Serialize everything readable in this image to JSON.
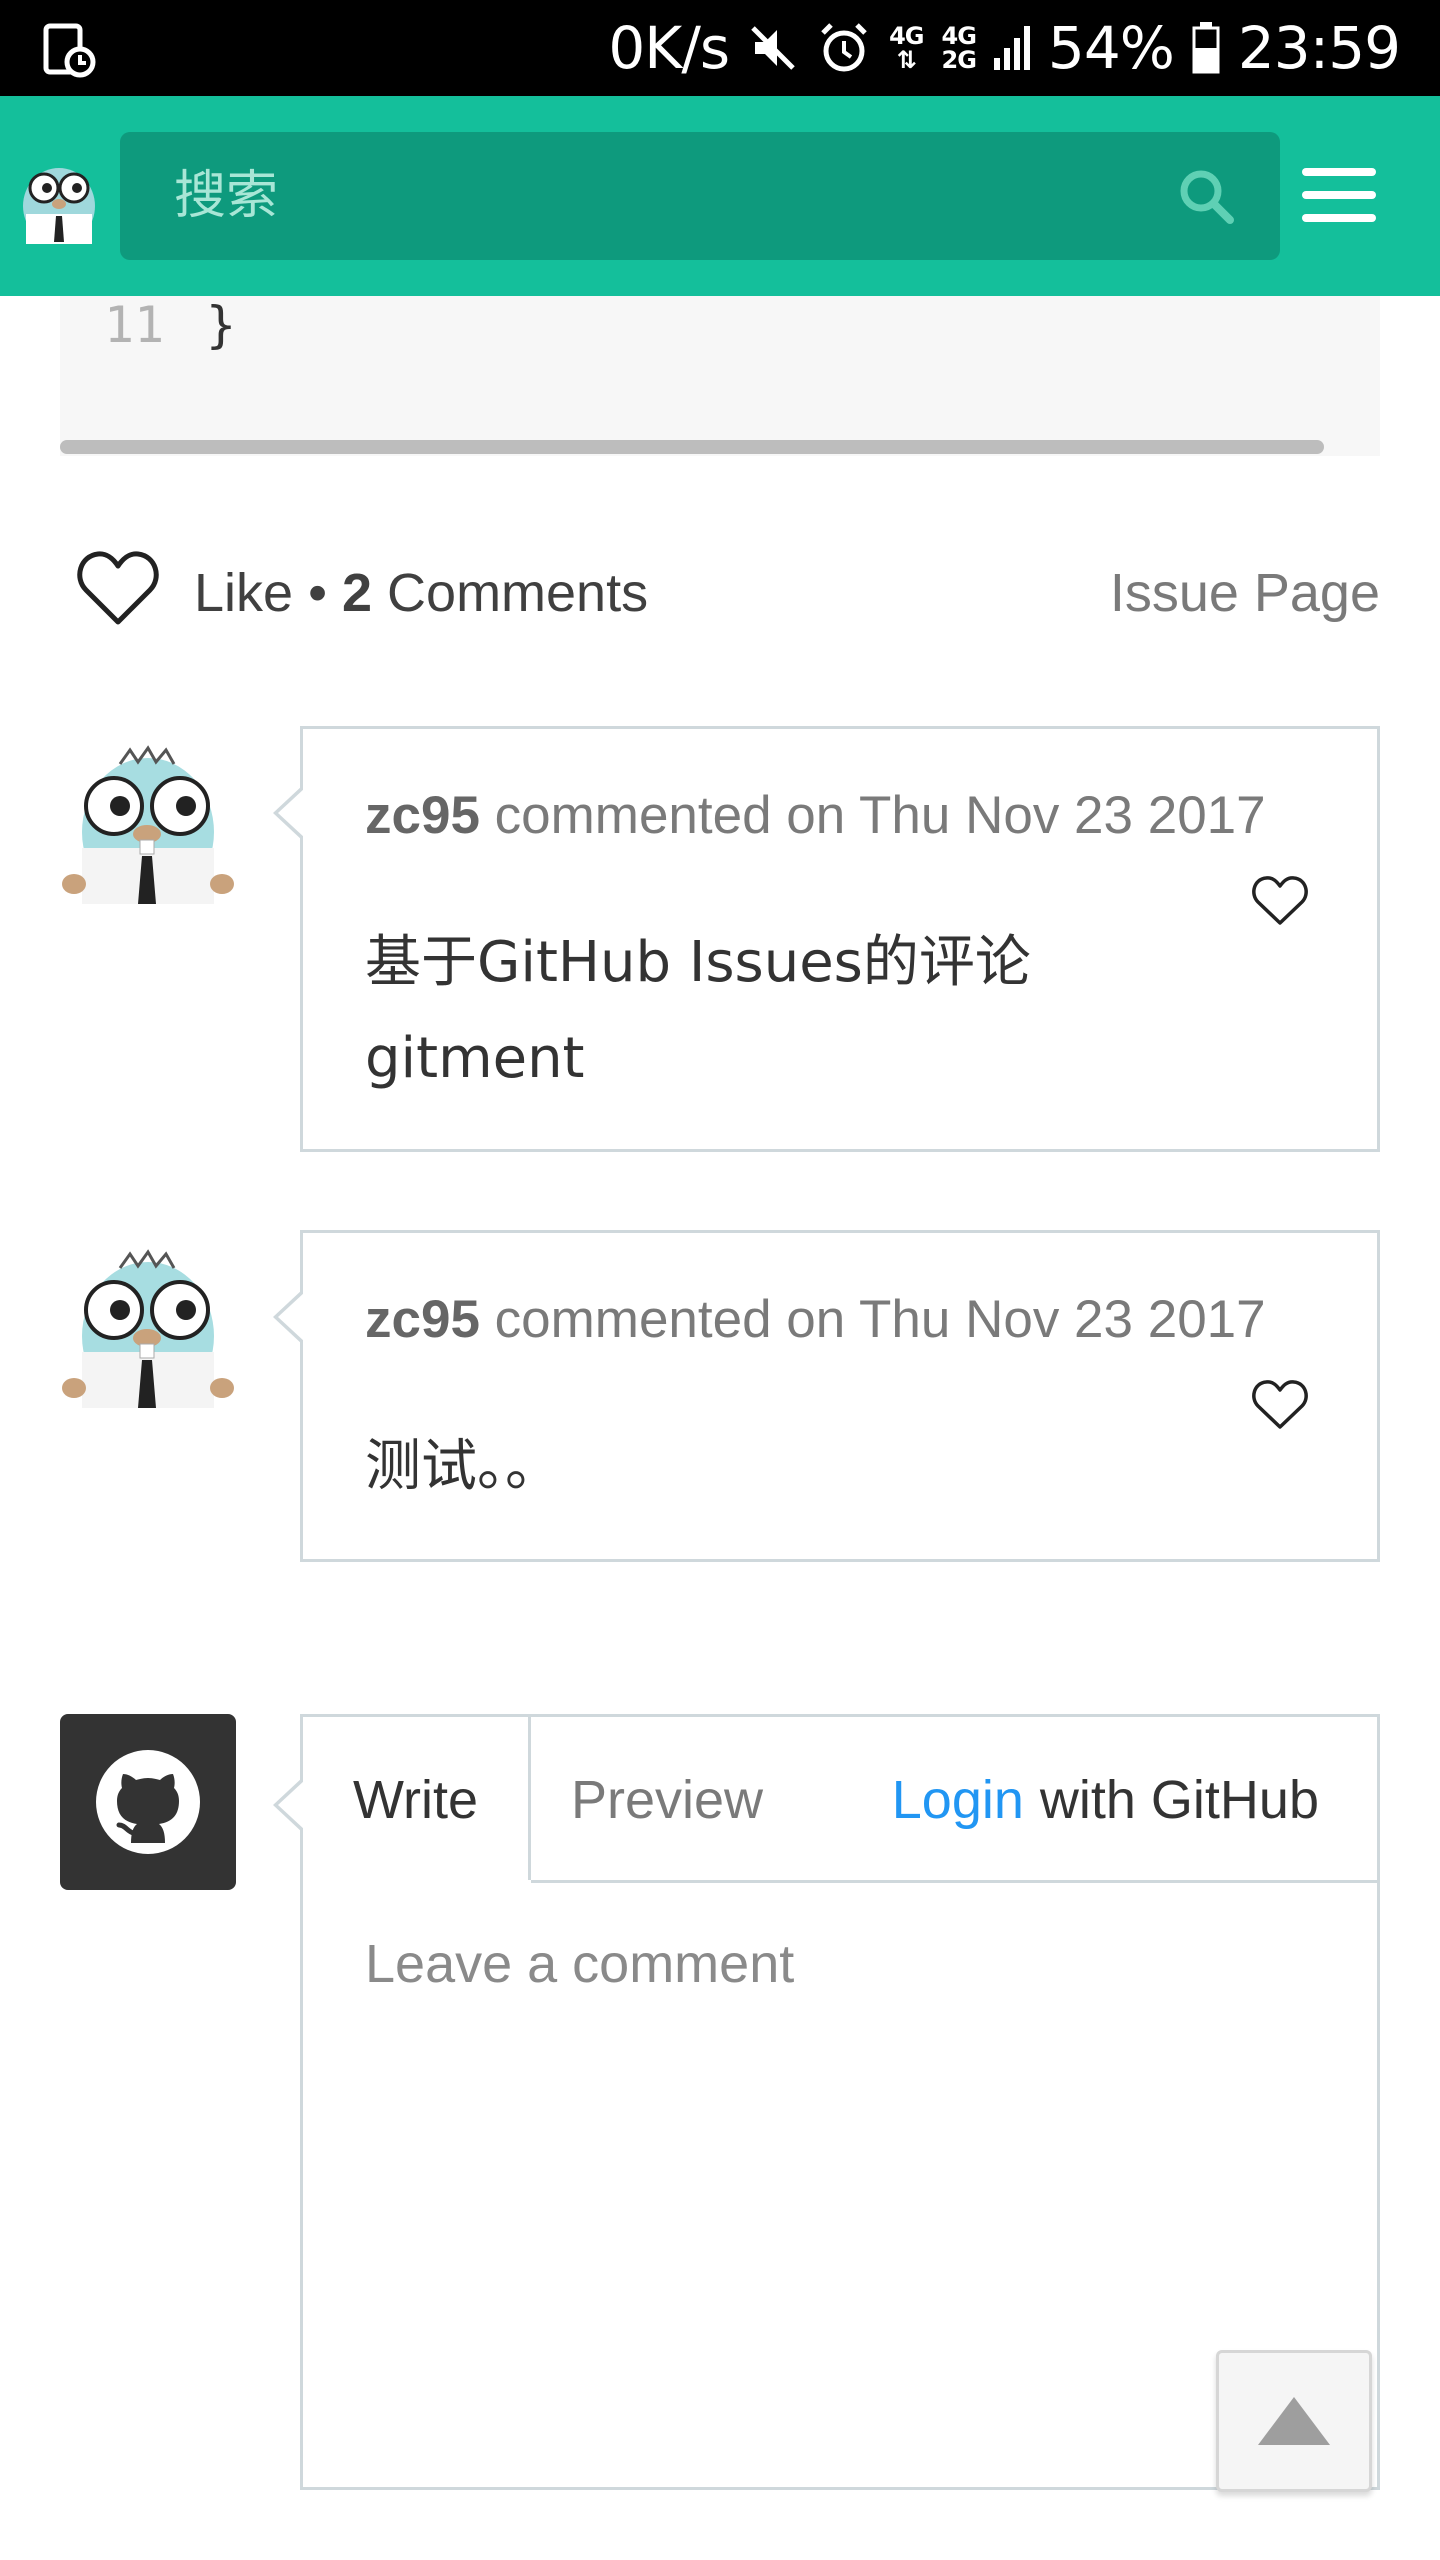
{
  "status_bar": {
    "speed": "0K/s",
    "network_top": "4G",
    "network_bottom": "2G",
    "battery": "54%",
    "time": "23:59"
  },
  "header": {
    "search_placeholder": "搜索"
  },
  "code": {
    "line_number": "11",
    "line_text": "}"
  },
  "meta": {
    "like_label": "Like",
    "separator": " • ",
    "comments_count": "2",
    "comments_label": " Comments",
    "issue_page": "Issue Page"
  },
  "comments": [
    {
      "author": "zc95",
      "action": " commented on Thu Nov 23 2017",
      "body_line1": "基于GitHub Issues的评论",
      "body_line2": "gitment"
    },
    {
      "author": "zc95",
      "action": " commented on Thu Nov 23 2017",
      "body_line1": "测试。。"
    }
  ],
  "editor": {
    "tab_write": "Write",
    "tab_preview": "Preview",
    "login_link": "Login",
    "login_suffix": "with GitHub",
    "textarea_placeholder": "Leave a comment"
  },
  "colors": {
    "header": "#14bf9b",
    "search_box": "#0e9a7d",
    "link": "#2196f3",
    "border": "#cfd8dc"
  }
}
